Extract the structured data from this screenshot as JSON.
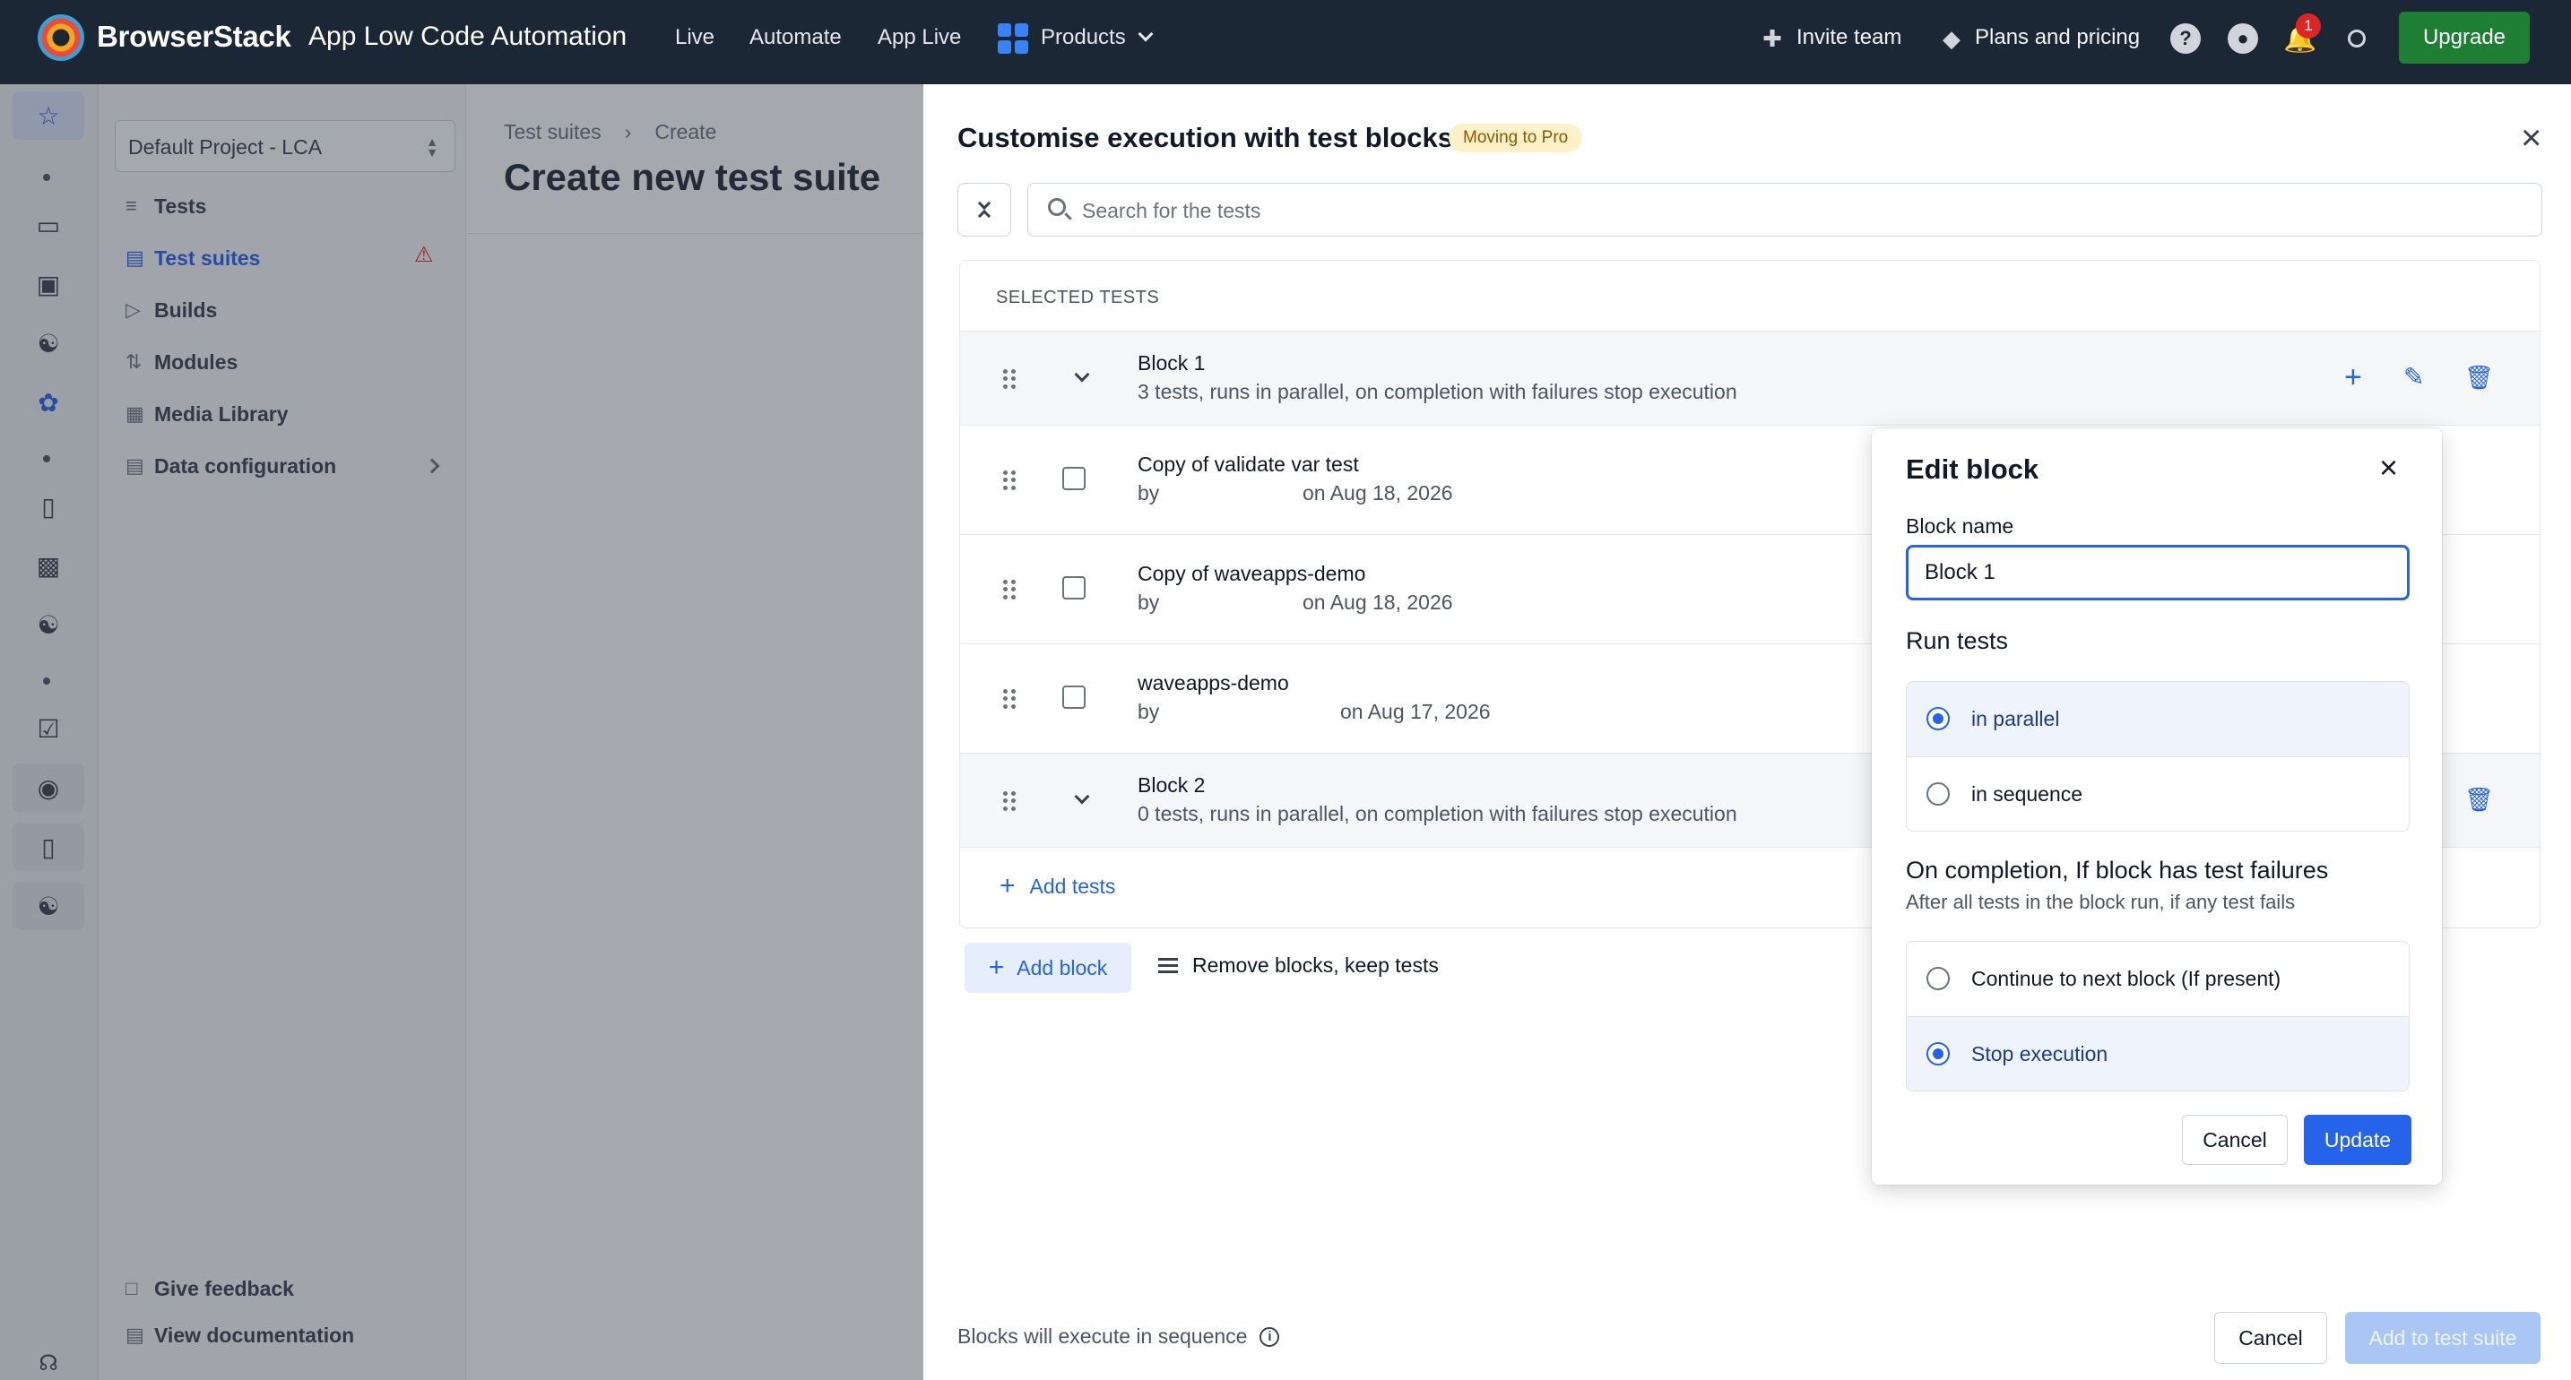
{
  "topnav": {
    "brand": "BrowserStack",
    "product": "App Low Code Automation",
    "links": [
      "Live",
      "Automate",
      "App Live",
      "Products"
    ],
    "invite_team": "Invite team",
    "plans_pricing": "Plans and pricing",
    "notification_count": "1",
    "upgrade": "Upgrade"
  },
  "sidebar": {
    "project": "Default Project - LCA",
    "items": [
      {
        "label": "Tests",
        "icon": "tests-icon"
      },
      {
        "label": "Test suites",
        "icon": "test-suites-icon",
        "active": true,
        "warning": true
      },
      {
        "label": "Builds",
        "icon": "play-icon"
      },
      {
        "label": "Modules",
        "icon": "modules-icon"
      },
      {
        "label": "Media Library",
        "icon": "media-icon"
      },
      {
        "label": "Data configuration",
        "icon": "data-config-icon"
      }
    ],
    "give_feedback": "Give feedback",
    "view_documentation": "View documentation"
  },
  "main": {
    "breadcrumb": [
      "Test suites",
      "Create"
    ],
    "title": "Create new test suite"
  },
  "drawer": {
    "title": "Customise execution with test blocks",
    "badge": "Moving to Pro",
    "search_placeholder": "Search for the tests",
    "section_label": "SELECTED TESTS",
    "block1": {
      "title": "Block 1",
      "subtitle": "3 tests, runs in parallel, on completion with failures stop execution"
    },
    "tests": [
      {
        "name": "Copy of validate var test",
        "by": "by",
        "date": "on Aug 18, 2026"
      },
      {
        "name": "Copy of waveapps-demo",
        "by": "by",
        "date": "on Aug 18, 2026"
      },
      {
        "name": "waveapps-demo",
        "by": "by",
        "date": "on Aug 17, 2026"
      }
    ],
    "block2": {
      "title": "Block 2",
      "subtitle": "0 tests, runs in parallel, on completion with failures stop execution"
    },
    "add_tests": "Add tests",
    "add_block": "Add block",
    "remove_blocks": "Remove blocks, keep tests",
    "footer_note": "Blocks will execute in sequence",
    "cancel": "Cancel",
    "add_to_suite": "Add to test suite"
  },
  "edit_block": {
    "title": "Edit block",
    "name_label": "Block name",
    "name_value": "Block 1",
    "run_tests_label": "Run tests",
    "run_options": [
      "in parallel",
      "in sequence"
    ],
    "run_selected": "in parallel",
    "completion_label": "On completion, If block has test failures",
    "completion_desc": "After all tests in the block run, if any test fails",
    "completion_options": [
      "Continue to next block (If present)",
      "Stop execution"
    ],
    "completion_selected": "Stop execution",
    "cancel": "Cancel",
    "update": "Update"
  },
  "colors": {
    "nav_bg": "#1b2735",
    "accent": "#2563eb",
    "upgrade": "#1e7e34",
    "badge_bg": "#fdf1c9"
  }
}
